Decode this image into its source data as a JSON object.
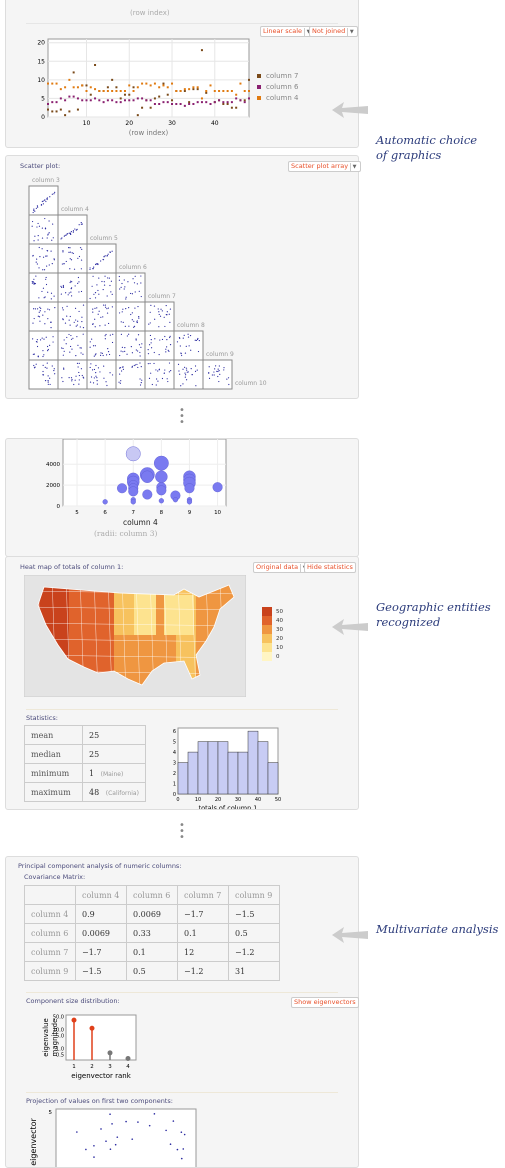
{
  "panel1": {
    "top_axis_label": "(row index)",
    "scale_select": "Linear scale",
    "join_select": "Not joined"
  },
  "callouts": {
    "graphics": [
      "Automatic choice",
      "of graphics"
    ],
    "geo": [
      "Geographic entities",
      "recognized"
    ],
    "multi": [
      "Multivariate analysis"
    ]
  },
  "scatter": {
    "title": "Scatter plot:",
    "select": "Scatter plot array",
    "columns": [
      "column 3",
      "column 4",
      "column 5",
      "column 6",
      "column 7",
      "column 8",
      "column 9",
      "column 10"
    ]
  },
  "bubble": {
    "xlabel": "column 4",
    "radii_label": "(radii: column 3)"
  },
  "heatmap": {
    "title": "Heat map of totals of column 1:",
    "data_select": "Original data",
    "hide_button": "Hide statistics",
    "legend": [
      "50",
      "40",
      "30",
      "20",
      "10",
      "0"
    ],
    "colors": [
      "#c9421c",
      "#e0632c",
      "#ef9641",
      "#f7c25e",
      "#fde38f",
      "#fff5c4"
    ]
  },
  "statistics": {
    "title": "Statistics:",
    "rows": [
      {
        "label": "mean",
        "value": "25",
        "note": ""
      },
      {
        "label": "median",
        "value": "25",
        "note": ""
      },
      {
        "label": "minimum",
        "value": "1",
        "note": "(Maine)"
      },
      {
        "label": "maximum",
        "value": "48",
        "note": "(California)"
      }
    ]
  },
  "pca": {
    "title": "Principal component analysis of numeric columns:",
    "cov_title": "Covariance Matrix:",
    "headers": [
      "column 4",
      "column 6",
      "column 7",
      "column 9"
    ],
    "rows": [
      [
        "column 4",
        "0.9",
        "0.0069",
        "−1.7",
        "−1.5"
      ],
      [
        "column 6",
        "0.0069",
        "0.33",
        "0.1",
        "0.5"
      ],
      [
        "column 7",
        "−1.7",
        "0.1",
        "12",
        "−1.2"
      ],
      [
        "column 9",
        "−1.5",
        "0.5",
        "−1.2",
        "31"
      ]
    ],
    "component_title": "Component size distribution:",
    "show_button": "Show eigenvectors",
    "projection_title": "Projection of values on first two components:",
    "projection_ylabel": "eigenvector",
    "projection_ytick": "5"
  },
  "chart_data": [
    {
      "type": "scatter",
      "xlabel": "(row index)",
      "xlim": [
        1,
        48
      ],
      "ylim": [
        0,
        21
      ],
      "xticks": [
        "10",
        "20",
        "30",
        "40"
      ],
      "yticks": [
        "0",
        "5",
        "10",
        "15",
        "20"
      ],
      "legend_position": "right",
      "grid": true,
      "series": [
        {
          "name": "column 7",
          "color": "#7a4a1a",
          "values": [
            2,
            1.5,
            1.5,
            2,
            0.5,
            1.5,
            12,
            2,
            8.5,
            8.5,
            6,
            14,
            7,
            7,
            8,
            10,
            8,
            5,
            6,
            6,
            8,
            0.5,
            2.5,
            4.5,
            2.5,
            5,
            5.5,
            9,
            6,
            4.5,
            7,
            7,
            7,
            4,
            7.5,
            7.5,
            18,
            6.5,
            3.5,
            4,
            4.5,
            3.5,
            3.5,
            2.5,
            2.5,
            4.5,
            4.5,
            10
          ]
        },
        {
          "name": "column 6",
          "color": "#8a2070",
          "values": [
            3.5,
            4,
            4,
            5,
            4.5,
            5.5,
            5.5,
            5,
            4.5,
            4.5,
            4.5,
            5,
            4.5,
            4,
            4.5,
            4.5,
            4,
            4,
            4.5,
            4.5,
            4.5,
            5,
            5,
            4.5,
            4.5,
            3.5,
            3.5,
            4,
            4,
            3.5,
            3.5,
            3.5,
            3,
            3.5,
            3.5,
            4,
            4,
            4,
            3.5,
            4,
            4.5,
            4,
            4,
            4,
            5,
            4.5,
            4,
            5
          ]
        },
        {
          "name": "column 4",
          "color": "#e07a10",
          "values": [
            9,
            9,
            9,
            7.5,
            8,
            10,
            8,
            8,
            8.5,
            7,
            8,
            7.5,
            7,
            7,
            7,
            7,
            7,
            7,
            7,
            8.5,
            7,
            8,
            9,
            9,
            8.5,
            9,
            8,
            8.5,
            8,
            9,
            7,
            7,
            7.5,
            7.5,
            8,
            8,
            5,
            7,
            8.5,
            7,
            7,
            7,
            7,
            7,
            6,
            9,
            7,
            7
          ]
        }
      ]
    },
    {
      "type": "bubble",
      "xlabel": "column 4",
      "xlim": [
        4.5,
        10.3
      ],
      "ylim": [
        0,
        5000
      ],
      "xticks": [
        "5",
        "6",
        "7",
        "8",
        "9",
        "10"
      ],
      "yticks": [
        "0",
        "2000",
        "4000"
      ],
      "points": [
        [
          6,
          400,
          1
        ],
        [
          6.6,
          1700,
          2
        ],
        [
          7,
          5000,
          3
        ],
        [
          7,
          2600,
          2.5
        ],
        [
          7,
          2300,
          2.5
        ],
        [
          7,
          2000,
          2
        ],
        [
          7,
          1700,
          2
        ],
        [
          7,
          1400,
          2
        ],
        [
          7,
          600,
          1
        ],
        [
          7,
          400,
          1
        ],
        [
          7.5,
          3000,
          3
        ],
        [
          7.5,
          2800,
          2.5
        ],
        [
          7.5,
          1100,
          2
        ],
        [
          8,
          4100,
          3
        ],
        [
          8,
          2800,
          2.5
        ],
        [
          8,
          1800,
          2
        ],
        [
          8,
          1500,
          2
        ],
        [
          8,
          500,
          1
        ],
        [
          8.5,
          1000,
          2
        ],
        [
          8.5,
          600,
          1
        ],
        [
          9,
          2800,
          2.5
        ],
        [
          9,
          2500,
          2.5
        ],
        [
          9,
          2200,
          2.5
        ],
        [
          9,
          1700,
          2
        ],
        [
          9,
          600,
          1
        ],
        [
          9,
          400,
          1
        ],
        [
          10,
          1800,
          2
        ]
      ]
    },
    {
      "type": "bar",
      "xlabel": "totals of column 1",
      "bins": [
        0,
        5,
        10,
        15,
        20,
        25,
        30,
        35,
        40,
        45,
        50
      ],
      "values": [
        3,
        4,
        5,
        5,
        5,
        4,
        4,
        6,
        5,
        3
      ],
      "xticks": [
        "0",
        "10",
        "20",
        "30",
        "40",
        "50"
      ],
      "yticks": [
        "0",
        "1",
        "2",
        "3",
        "4",
        "5",
        "6"
      ]
    },
    {
      "type": "stem",
      "xlabel": "eigenvector rank",
      "ylabel": "eigenvalue magnitude",
      "scale": "log",
      "categories": [
        "1",
        "2",
        "3",
        "4"
      ],
      "values": [
        32,
        12,
        0.6,
        0.3
      ],
      "colors": [
        "#e0401a",
        "#e0401a",
        "#777",
        "#777"
      ],
      "yticks": [
        "50.0",
        "10.0",
        "5.0",
        "1.0",
        "0.5"
      ]
    }
  ]
}
